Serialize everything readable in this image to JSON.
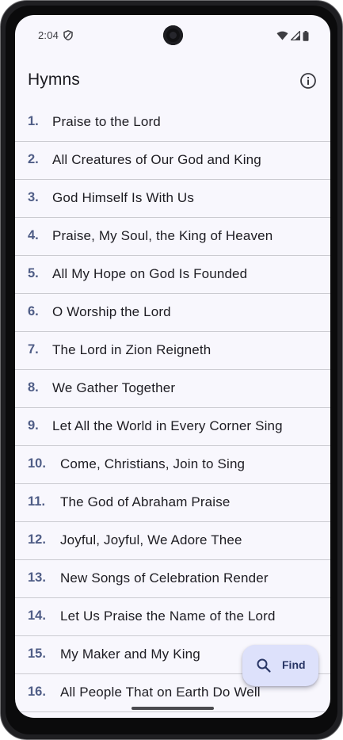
{
  "status_bar": {
    "time": "2:04",
    "left_icons": [
      "shield-icon"
    ],
    "right_icons": [
      "wifi-icon",
      "signal-icon",
      "battery-icon"
    ]
  },
  "app_bar": {
    "title": "Hymns",
    "action_icon": "info-icon"
  },
  "hymns": [
    {
      "number": "1.",
      "title": "Praise to the Lord"
    },
    {
      "number": "2.",
      "title": "All Creatures of Our God and King"
    },
    {
      "number": "3.",
      "title": "God Himself Is With Us"
    },
    {
      "number": "4.",
      "title": "Praise, My Soul, the King of Heaven"
    },
    {
      "number": "5.",
      "title": "All My Hope on God Is Founded"
    },
    {
      "number": "6.",
      "title": "O Worship the Lord"
    },
    {
      "number": "7.",
      "title": "The Lord in Zion Reigneth"
    },
    {
      "number": "8.",
      "title": "We Gather Together"
    },
    {
      "number": "9.",
      "title": "Let All the World in Every Corner Sing"
    },
    {
      "number": "10.",
      "title": "Come, Christians, Join to Sing"
    },
    {
      "number": "11.",
      "title": "The God of Abraham Praise"
    },
    {
      "number": "12.",
      "title": "Joyful, Joyful, We Adore Thee"
    },
    {
      "number": "13.",
      "title": "New Songs of Celebration Render"
    },
    {
      "number": "14.",
      "title": "Let Us Praise the Name of the Lord"
    },
    {
      "number": "15.",
      "title": "My Maker and My King"
    },
    {
      "number": "16.",
      "title": "All People That on Earth Do Well"
    }
  ],
  "fab": {
    "label": "Find",
    "icon": "search-icon"
  },
  "colors": {
    "background": "#f8f7fd",
    "number_accent": "#4f5d86",
    "fab_background": "#dde1fb",
    "fab_text": "#283565",
    "divider": "#cbcbd1"
  }
}
